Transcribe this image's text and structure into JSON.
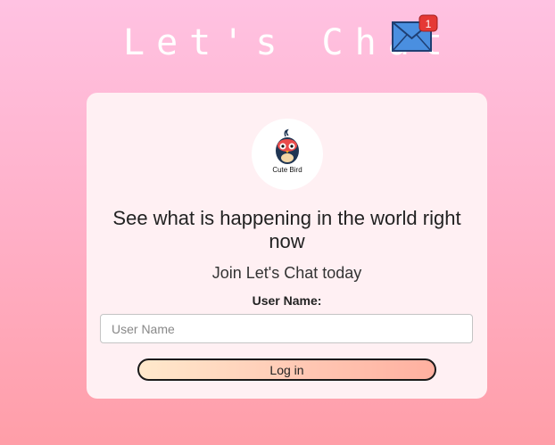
{
  "header": {
    "title": "Let's Chat",
    "notification_count": "1"
  },
  "logo": {
    "text": "Cute Bird"
  },
  "card": {
    "headline": "See what is happening in the world right now",
    "subhead": "Join Let's Chat today"
  },
  "form": {
    "username_label": "User Name:",
    "username_placeholder": "User Name",
    "username_value": "",
    "login_label": "Log in"
  },
  "colors": {
    "background_top": "#ffc2e2",
    "background_bottom": "#ff9ea8",
    "card_background": "#fff0f3",
    "envelope_blue": "#4a8fe0",
    "badge_red": "#e53935"
  }
}
